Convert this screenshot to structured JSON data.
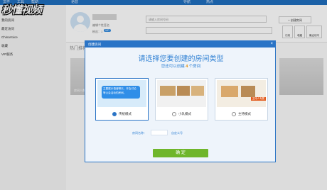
{
  "topbar": {
    "left_tabs": [
      "文件",
      "工具",
      "帮助"
    ],
    "app_name": "语音",
    "right_tabs": [
      "导航",
      "热点"
    ]
  },
  "left_nav": {
    "items": [
      "我的房间",
      "最近访问",
      "ChinaVoice",
      "收藏",
      "VIP服务"
    ]
  },
  "watermark": "秒懂视频",
  "profile": {
    "signature": "编辑个性签名",
    "fans_prefix": "粉丝：1",
    "badge": "VIP"
  },
  "search": {
    "placeholder": "请输入房间号码"
  },
  "actions": {
    "create_room": "+ 创建房间",
    "btn1": "订阅",
    "btn2": "收藏",
    "btn3": "最近访问"
  },
  "hot_section": {
    "title": "热门推荐",
    "room_label": "房间人数"
  },
  "dialog": {
    "title": "创建房间",
    "close": "×",
    "heading": "请选择您要创建的房间类型",
    "sub_prefix": "您还可以创建 ",
    "sub_count": "4",
    "sub_suffix": " 个房间",
    "cards": [
      {
        "label": "传统模式",
        "selected": true,
        "bubble_text": "主要展示语音聊天，开会讨论等公会活动的房间。"
      },
      {
        "label": "小队模式",
        "selected": false
      },
      {
        "label": "主持模式",
        "selected": false,
        "tag": "主持人专属"
      }
    ],
    "name_label": "房间名称：",
    "custom_link": "自定义号",
    "ok": "确  定"
  },
  "colors": {
    "brand": "#2a74c6",
    "accent_orange": "#e08a00",
    "ok_green": "#6fb62b"
  }
}
